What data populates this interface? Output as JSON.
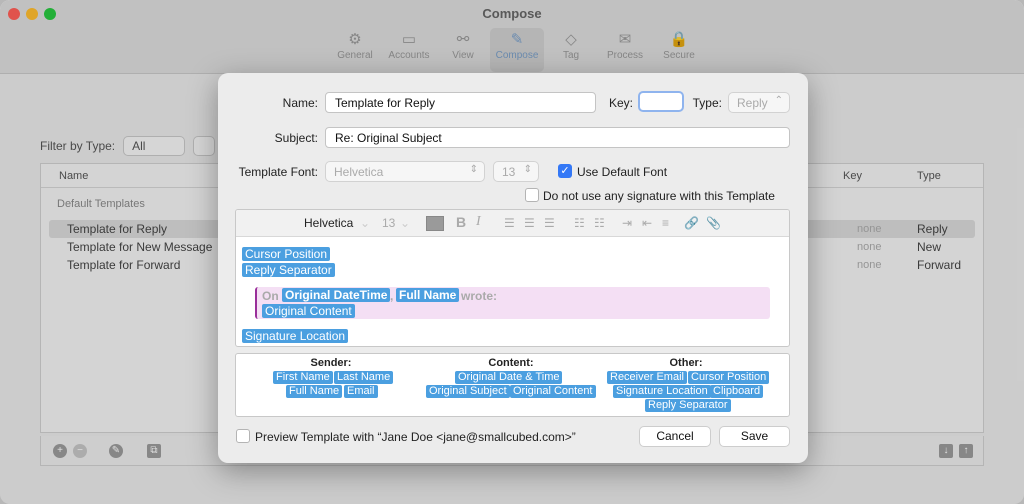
{
  "window": {
    "title": "Compose",
    "toolbar": [
      {
        "label": "General",
        "icon": "gear-icon",
        "glyph": "⚙"
      },
      {
        "label": "Accounts",
        "icon": "accounts-icon",
        "glyph": "▭"
      },
      {
        "label": "View",
        "icon": "glasses-icon",
        "glyph": "⚯"
      },
      {
        "label": "Compose",
        "icon": "compose-icon",
        "glyph": "✎"
      },
      {
        "label": "Tag",
        "icon": "tag-icon",
        "glyph": "◇"
      },
      {
        "label": "Process",
        "icon": "process-icon",
        "glyph": "✉"
      },
      {
        "label": "Secure",
        "icon": "lock-icon",
        "glyph": "🔒"
      }
    ],
    "filter_label": "Filter by Type:",
    "filter_value": "All",
    "list": {
      "col_name": "Name",
      "col_key": "Key",
      "col_type": "Type",
      "group": "Default Templates",
      "rows": [
        {
          "name": "Template for Reply",
          "key": "none",
          "type": "Reply"
        },
        {
          "name": "Template for New Message",
          "key": "none",
          "type": "New"
        },
        {
          "name": "Template for Forward",
          "key": "none",
          "type": "Forward"
        }
      ]
    }
  },
  "dialog": {
    "name_label": "Name:",
    "name_value": "Template for Reply",
    "key_label": "Key:",
    "key_value": "",
    "type_label": "Type:",
    "type_value": "Reply",
    "subject_label": "Subject:",
    "subject_value": "Re: Original Subject",
    "font_label": "Template Font:",
    "font_value": "Helvetica",
    "font_size": "13",
    "use_default_font": "Use Default Font",
    "no_signature": "Do not use any signature with this Template",
    "editor": {
      "font": "Helvetica",
      "size": "13",
      "tokens": {
        "cursor_position": "Cursor Position",
        "reply_separator": "Reply Separator",
        "quote_on": "On",
        "original_datetime": "Original DateTime",
        "comma": ",",
        "full_name": "Full Name",
        "wrote": "wrote:",
        "original_content": "Original Content",
        "signature_location": "Signature Location"
      }
    },
    "variables": {
      "sender": {
        "title": "Sender:",
        "items": [
          "First Name",
          "Last Name",
          "Full Name",
          "Email"
        ]
      },
      "content": {
        "title": "Content:",
        "items": [
          "Original Date & Time",
          "Original Subject",
          "Original Content"
        ]
      },
      "other": {
        "title": "Other:",
        "items": [
          "Receiver Email",
          "Cursor Position",
          "Signature Location",
          "Clipboard",
          "Reply Separator"
        ]
      }
    },
    "preview_label": "Preview Template with “Jane Doe <jane@smallcubed.com>”",
    "cancel": "Cancel",
    "save": "Save"
  }
}
